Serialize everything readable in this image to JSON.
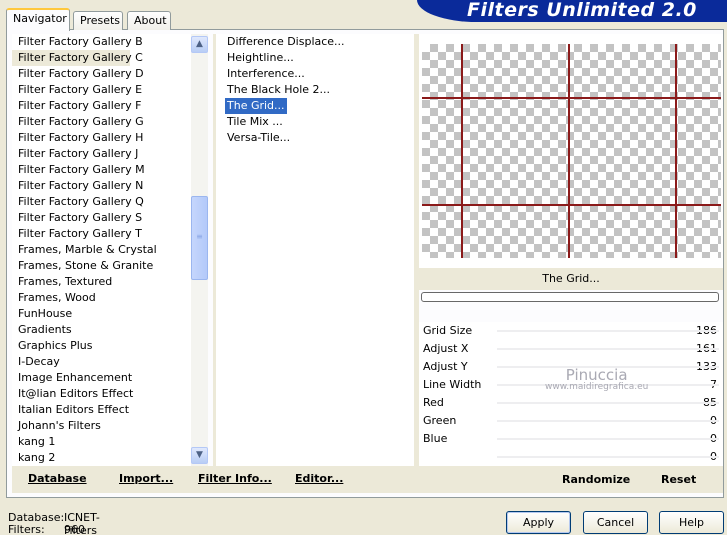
{
  "tabs": [
    {
      "label": "Navigator",
      "active": true
    },
    {
      "label": "Presets",
      "active": false
    },
    {
      "label": "About",
      "active": false
    }
  ],
  "banner_title": "Filters Unlimited 2.0",
  "categories": [
    "Filter Factory Gallery B",
    "Filter Factory Gallery C",
    "Filter Factory Gallery D",
    "Filter Factory Gallery E",
    "Filter Factory Gallery F",
    "Filter Factory Gallery G",
    "Filter Factory Gallery H",
    "Filter Factory Gallery J",
    "Filter Factory Gallery M",
    "Filter Factory Gallery N",
    "Filter Factory Gallery Q",
    "Filter Factory Gallery S",
    "Filter Factory Gallery T",
    "Frames, Marble & Crystal",
    "Frames, Stone & Granite",
    "Frames, Textured",
    "Frames, Wood",
    "FunHouse",
    "Gradients",
    "Graphics Plus",
    "I-Decay",
    "Image Enhancement",
    "It@lian Editors Effect",
    "Italian Editors Effect",
    "Johann's Filters",
    "kang 1",
    "kang 2"
  ],
  "selected_category_index": 1,
  "filters": [
    "Difference Displace...",
    "Heightline...",
    "Interference...",
    "The Black Hole 2...",
    "The Grid...",
    "Tile Mix ...",
    "Versa-Tile..."
  ],
  "selected_filter_index": 4,
  "preview": {
    "filter_name": "The Grid...",
    "progress": 0,
    "grid_color": "#8b1a1a"
  },
  "controls": [
    {
      "label": "Grid Size",
      "value": "186"
    },
    {
      "label": "Adjust X",
      "value": "161"
    },
    {
      "label": "Adjust Y",
      "value": "133"
    },
    {
      "label": "Line Width",
      "value": "7"
    },
    {
      "label": "Red",
      "value": "85"
    },
    {
      "label": "Green",
      "value": "0"
    },
    {
      "label": "Blue",
      "value": "0"
    },
    {
      "label": "",
      "value": "0"
    }
  ],
  "watermark": {
    "name": "Pinuccia",
    "url": "www.maidiregrafica.eu"
  },
  "bottom_buttons": {
    "database": "Database",
    "import": "Import...",
    "filter_info": "Filter Info...",
    "editor": "Editor...",
    "randomize": "Randomize",
    "reset": "Reset"
  },
  "status": {
    "database_label": "Database:",
    "database_value": "ICNET-Filters",
    "filters_label": "Filters:",
    "filters_value": "960"
  },
  "dialog_buttons": {
    "apply": "Apply",
    "cancel": "Cancel",
    "help": "Help"
  },
  "colors": {
    "selection": "#316ac5",
    "banner": "#0a2a9a",
    "face": "#ece9d8"
  },
  "icons": {
    "scroll_up": "chevron-up-icon",
    "scroll_down": "chevron-down-icon",
    "scroll_grip": "grip-icon"
  }
}
